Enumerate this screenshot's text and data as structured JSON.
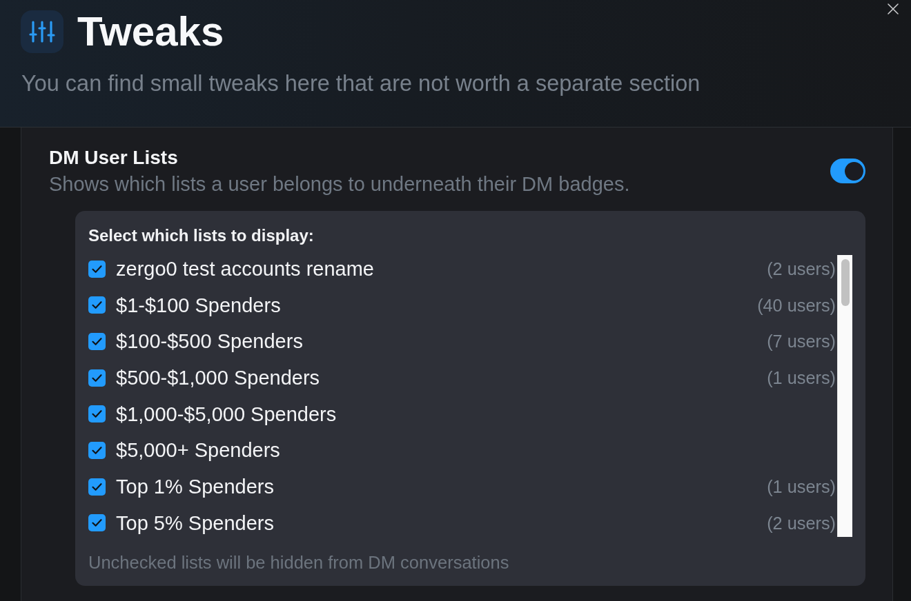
{
  "header": {
    "title": "Tweaks",
    "subtitle": "You can find small tweaks here that are not worth a separate section"
  },
  "setting": {
    "title": "DM User Lists",
    "description": "Shows which lists a user belongs to underneath their DM badges.",
    "on": true,
    "list_panel": {
      "heading": "Select which lists to display:",
      "items": [
        {
          "label": "zergo0 test accounts rename",
          "count": "(2 users)",
          "checked": true
        },
        {
          "label": "$1-$100 Spenders",
          "count": "(40 users)",
          "checked": true
        },
        {
          "label": "$100-$500 Spenders",
          "count": "(7 users)",
          "checked": true
        },
        {
          "label": "$500-$1,000 Spenders",
          "count": "(1 users)",
          "checked": true
        },
        {
          "label": "$1,000-$5,000 Spenders",
          "checked": true
        },
        {
          "label": "$5,000+ Spenders",
          "checked": true
        },
        {
          "label": "Top 1% Spenders",
          "count": "(1 users)",
          "checked": true
        },
        {
          "label": "Top 5% Spenders",
          "count": "(2 users)",
          "checked": true
        }
      ],
      "footnote": "Unchecked lists will be hidden from DM conversations"
    }
  }
}
